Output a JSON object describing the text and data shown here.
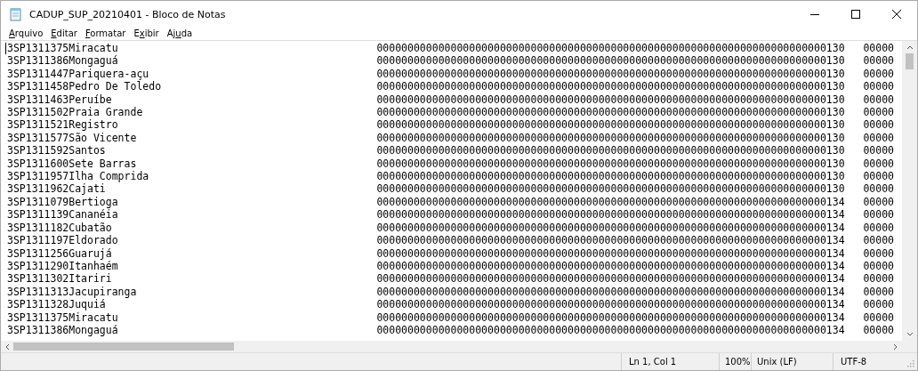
{
  "window": {
    "title": "CADUP_SUP_20210401 - Bloco de Notas"
  },
  "menu": [
    {
      "key": "A",
      "after": "rquivo"
    },
    {
      "key": "E",
      "after": "ditar"
    },
    {
      "key": "F",
      "after": "ormatar"
    },
    {
      "before": "E",
      "key": "x",
      "after": "ibir"
    },
    {
      "before": "Aj",
      "key": "u",
      "after": "da"
    }
  ],
  "lines": [
    {
      "text": "3SP1311375Miracatu",
      "column_2": "0000000000000000000000000000000000000000000000000000000000000000000000000130",
      "column_3": "00000"
    },
    {
      "text": "3SP1311386Mongaguá",
      "column_2": "0000000000000000000000000000000000000000000000000000000000000000000000000130",
      "column_3": "00000"
    },
    {
      "text": "3SP1311447Pariquera-açu",
      "column_2": "0000000000000000000000000000000000000000000000000000000000000000000000000130",
      "column_3": "00000"
    },
    {
      "text": "3SP1311458Pedro De Toledo",
      "column_2": "0000000000000000000000000000000000000000000000000000000000000000000000000130",
      "column_3": "00000"
    },
    {
      "text": "3SP1311463Peruíbe",
      "column_2": "0000000000000000000000000000000000000000000000000000000000000000000000000130",
      "column_3": "00000"
    },
    {
      "text": "3SP1311502Praia Grande",
      "column_2": "0000000000000000000000000000000000000000000000000000000000000000000000000130",
      "column_3": "00000"
    },
    {
      "text": "3SP1311521Registro",
      "column_2": "0000000000000000000000000000000000000000000000000000000000000000000000000130",
      "column_3": "00000"
    },
    {
      "text": "3SP1311577São Vicente",
      "column_2": "0000000000000000000000000000000000000000000000000000000000000000000000000130",
      "column_3": "00000"
    },
    {
      "text": "3SP1311592Santos",
      "column_2": "0000000000000000000000000000000000000000000000000000000000000000000000000130",
      "column_3": "00000"
    },
    {
      "text": "3SP1311600Sete Barras",
      "column_2": "0000000000000000000000000000000000000000000000000000000000000000000000000130",
      "column_3": "00000"
    },
    {
      "text": "3SP1311957Ilha Comprida",
      "column_2": "0000000000000000000000000000000000000000000000000000000000000000000000000130",
      "column_3": "00000"
    },
    {
      "text": "3SP1311962Cajati",
      "column_2": "0000000000000000000000000000000000000000000000000000000000000000000000000130",
      "column_3": "00000"
    },
    {
      "text": "3SP1311079Bertioga",
      "column_2": "0000000000000000000000000000000000000000000000000000000000000000000000000134",
      "column_3": "00000"
    },
    {
      "text": "3SP1311139Cananéia",
      "column_2": "0000000000000000000000000000000000000000000000000000000000000000000000000134",
      "column_3": "00000"
    },
    {
      "text": "3SP1311182Cubatão",
      "column_2": "0000000000000000000000000000000000000000000000000000000000000000000000000134",
      "column_3": "00000"
    },
    {
      "text": "3SP1311197Eldorado",
      "column_2": "0000000000000000000000000000000000000000000000000000000000000000000000000134",
      "column_3": "00000"
    },
    {
      "text": "3SP1311256Guarujá",
      "column_2": "0000000000000000000000000000000000000000000000000000000000000000000000000134",
      "column_3": "00000"
    },
    {
      "text": "3SP1311290Itanhaém",
      "column_2": "0000000000000000000000000000000000000000000000000000000000000000000000000134",
      "column_3": "00000"
    },
    {
      "text": "3SP1311302Itariri",
      "column_2": "0000000000000000000000000000000000000000000000000000000000000000000000000134",
      "column_3": "00000"
    },
    {
      "text": "3SP1311313Jacupiranga",
      "column_2": "0000000000000000000000000000000000000000000000000000000000000000000000000134",
      "column_3": "00000"
    },
    {
      "text": "3SP1311328Juquiá",
      "column_2": "0000000000000000000000000000000000000000000000000000000000000000000000000134",
      "column_3": "00000"
    },
    {
      "text": "3SP1311375Miracatu",
      "column_2": "0000000000000000000000000000000000000000000000000000000000000000000000000134",
      "column_3": "00000"
    },
    {
      "text": "3SP1311386Mongaguá",
      "column_2": "0000000000000000000000000000000000000000000000000000000000000000000000000134",
      "column_3": "00000"
    }
  ],
  "status_bar": {
    "position": "Ln 1, Col 1",
    "zoom": "100%",
    "line_ending": "Unix (LF)",
    "encoding": "UTF-8"
  }
}
